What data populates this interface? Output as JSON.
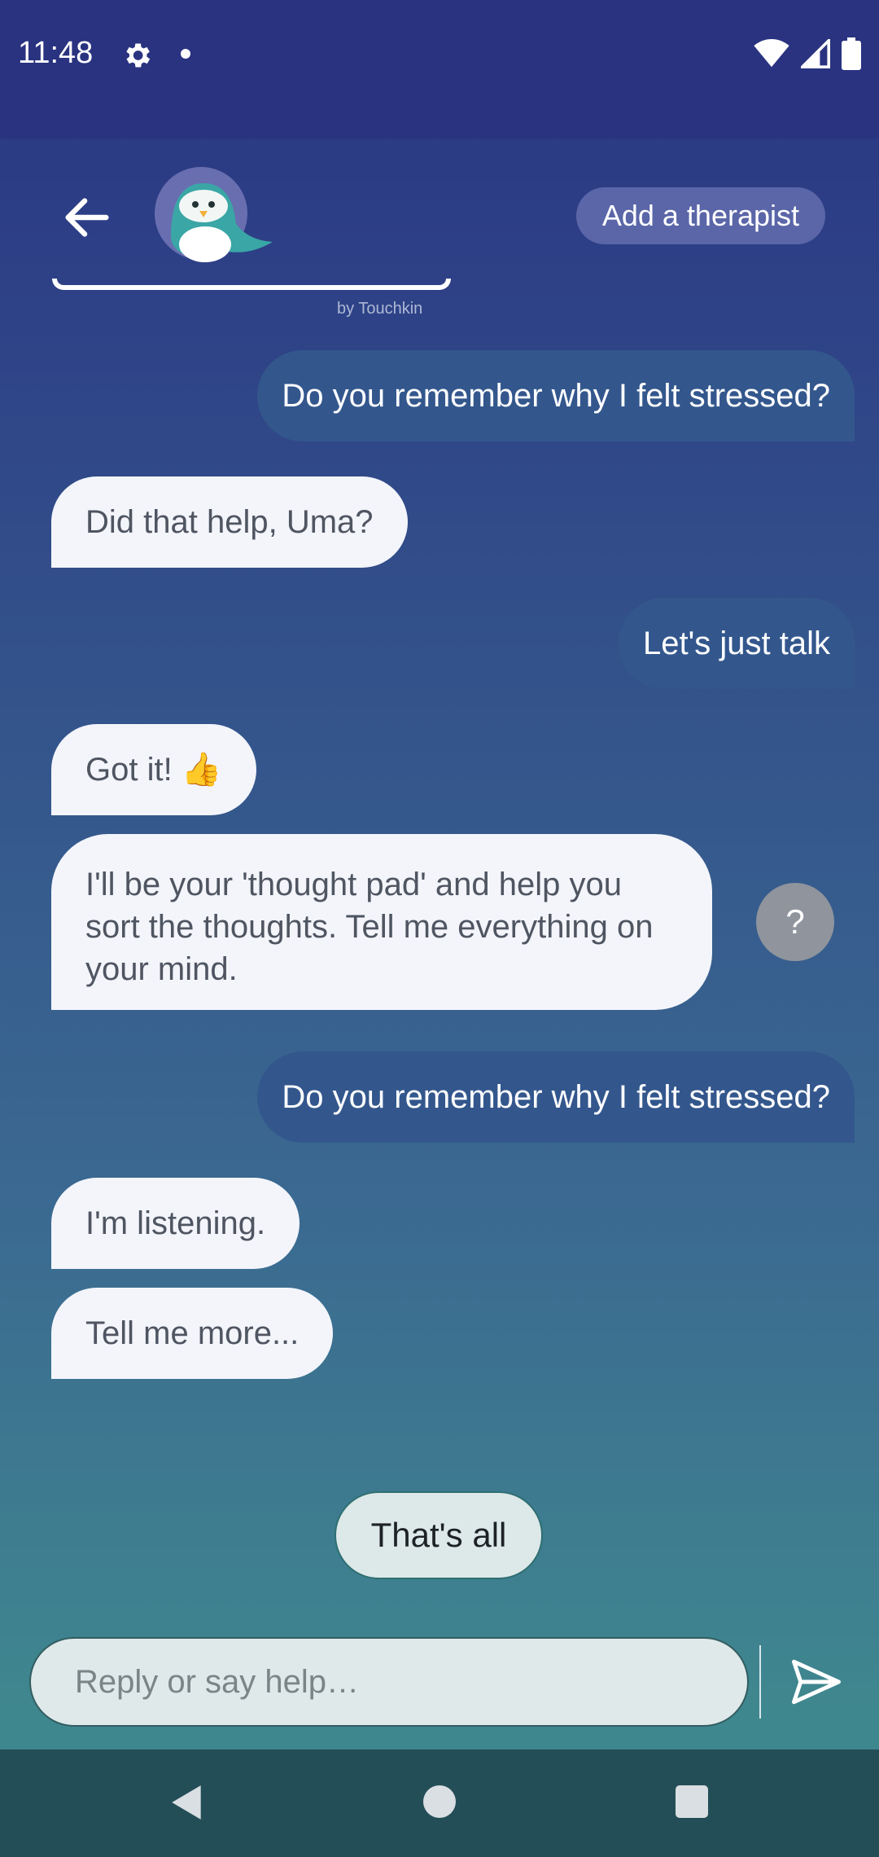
{
  "status_bar": {
    "time": "11:48"
  },
  "header": {
    "add_therapist_label": "Add a therapist",
    "by_line": "by Touchkin"
  },
  "messages": [
    {
      "from": "user",
      "text": "Do you remember why I felt stressed?"
    },
    {
      "from": "bot",
      "text": "Did that help, Uma?"
    },
    {
      "from": "user",
      "text": "Let's just talk"
    },
    {
      "from": "bot",
      "text": "Got it! 👍"
    },
    {
      "from": "bot",
      "text": "I'll be your 'thought pad' and help you sort the thoughts. Tell me everything on your mind."
    },
    {
      "from": "user",
      "text": "Do you remember why I felt stressed?"
    },
    {
      "from": "bot",
      "text": "I'm listening."
    },
    {
      "from": "bot",
      "text": "Tell me more..."
    }
  ],
  "help_button_label": "?",
  "quick_reply": "That's all",
  "composer": {
    "placeholder": "Reply or say help…"
  },
  "colors": {
    "user_bubble": "#33578d",
    "bot_bubble": "#f3f5fb",
    "nav_bar": "#244e57",
    "status_bar": "#293380"
  }
}
